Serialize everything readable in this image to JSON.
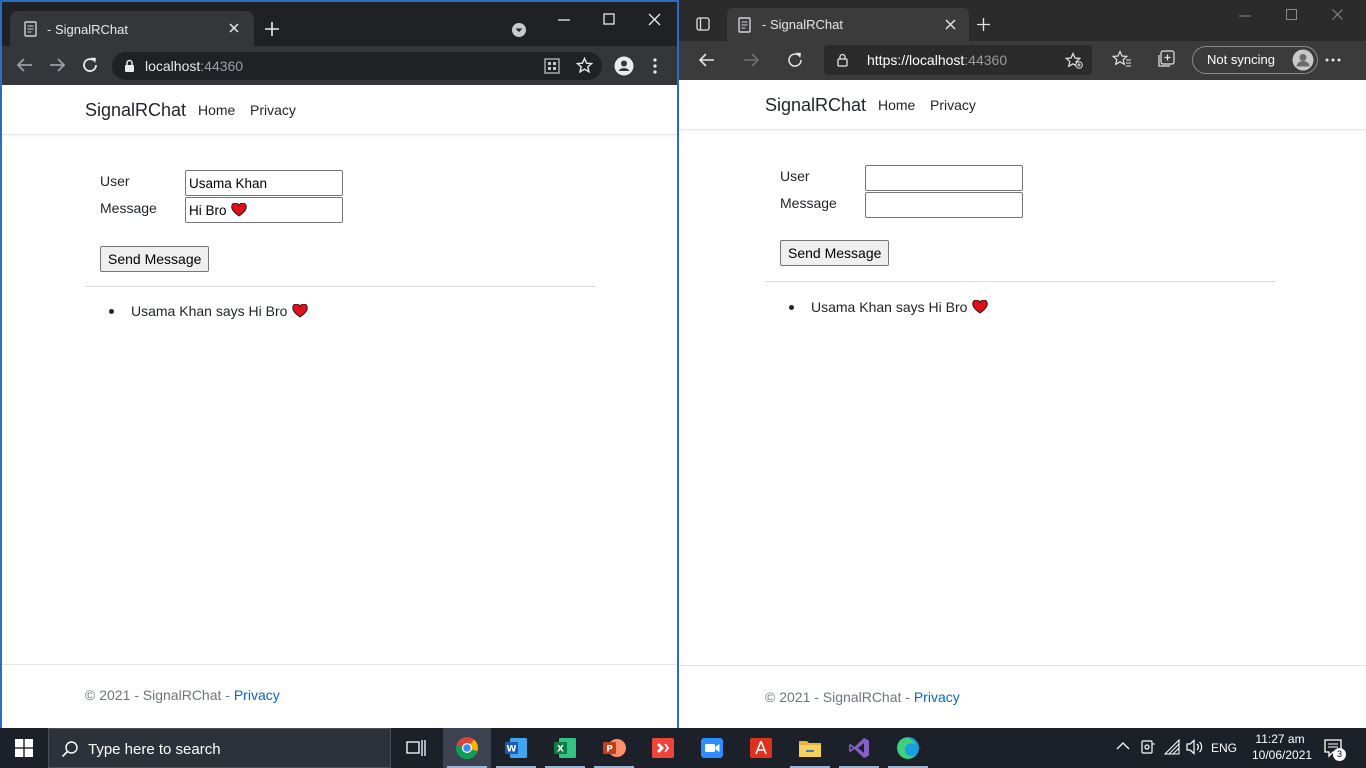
{
  "chrome": {
    "tab_title": "- SignalRChat",
    "url_host": "localhost",
    "url_port": ":44360",
    "page": {
      "brand": "SignalRChat",
      "nav": [
        "Home",
        "Privacy"
      ],
      "user_label": "User",
      "message_label": "Message",
      "user_value": "Usama Khan",
      "message_value": "Hi Bro",
      "send_label": "Send Message",
      "messages": [
        "Usama Khan says Hi Bro"
      ],
      "footer_text": "© 2021 - SignalRChat - ",
      "footer_link": "Privacy"
    }
  },
  "edge": {
    "tab_title": "- SignalRChat",
    "url_scheme": "https://",
    "url_host": "localhost",
    "url_port": ":44360",
    "sync_label": "Not syncing",
    "page": {
      "brand": "SignalRChat",
      "nav": [
        "Home",
        "Privacy"
      ],
      "user_label": "User",
      "message_label": "Message",
      "user_value": "",
      "message_value": "",
      "send_label": "Send Message",
      "messages": [
        "Usama Khan says Hi Bro"
      ],
      "footer_text": "© 2021 - SignalRChat - ",
      "footer_link": "Privacy"
    }
  },
  "taskbar": {
    "search_placeholder": "Type here to search",
    "apps": [
      "chrome-icon",
      "word-icon",
      "excel-icon",
      "powerpoint-icon",
      "anydesk-icon",
      "zoom-icon",
      "acrobat-icon",
      "file-explorer-icon",
      "visual-studio-icon",
      "edge-icon"
    ],
    "language": "ENG",
    "time": "11:27 am",
    "date": "10/06/2021",
    "notification_count": "3"
  },
  "colors": {
    "heart": "#e0101a",
    "link": "#0366d6",
    "chrome_dark": "#202124",
    "edge_dark": "#2b2b2b"
  }
}
